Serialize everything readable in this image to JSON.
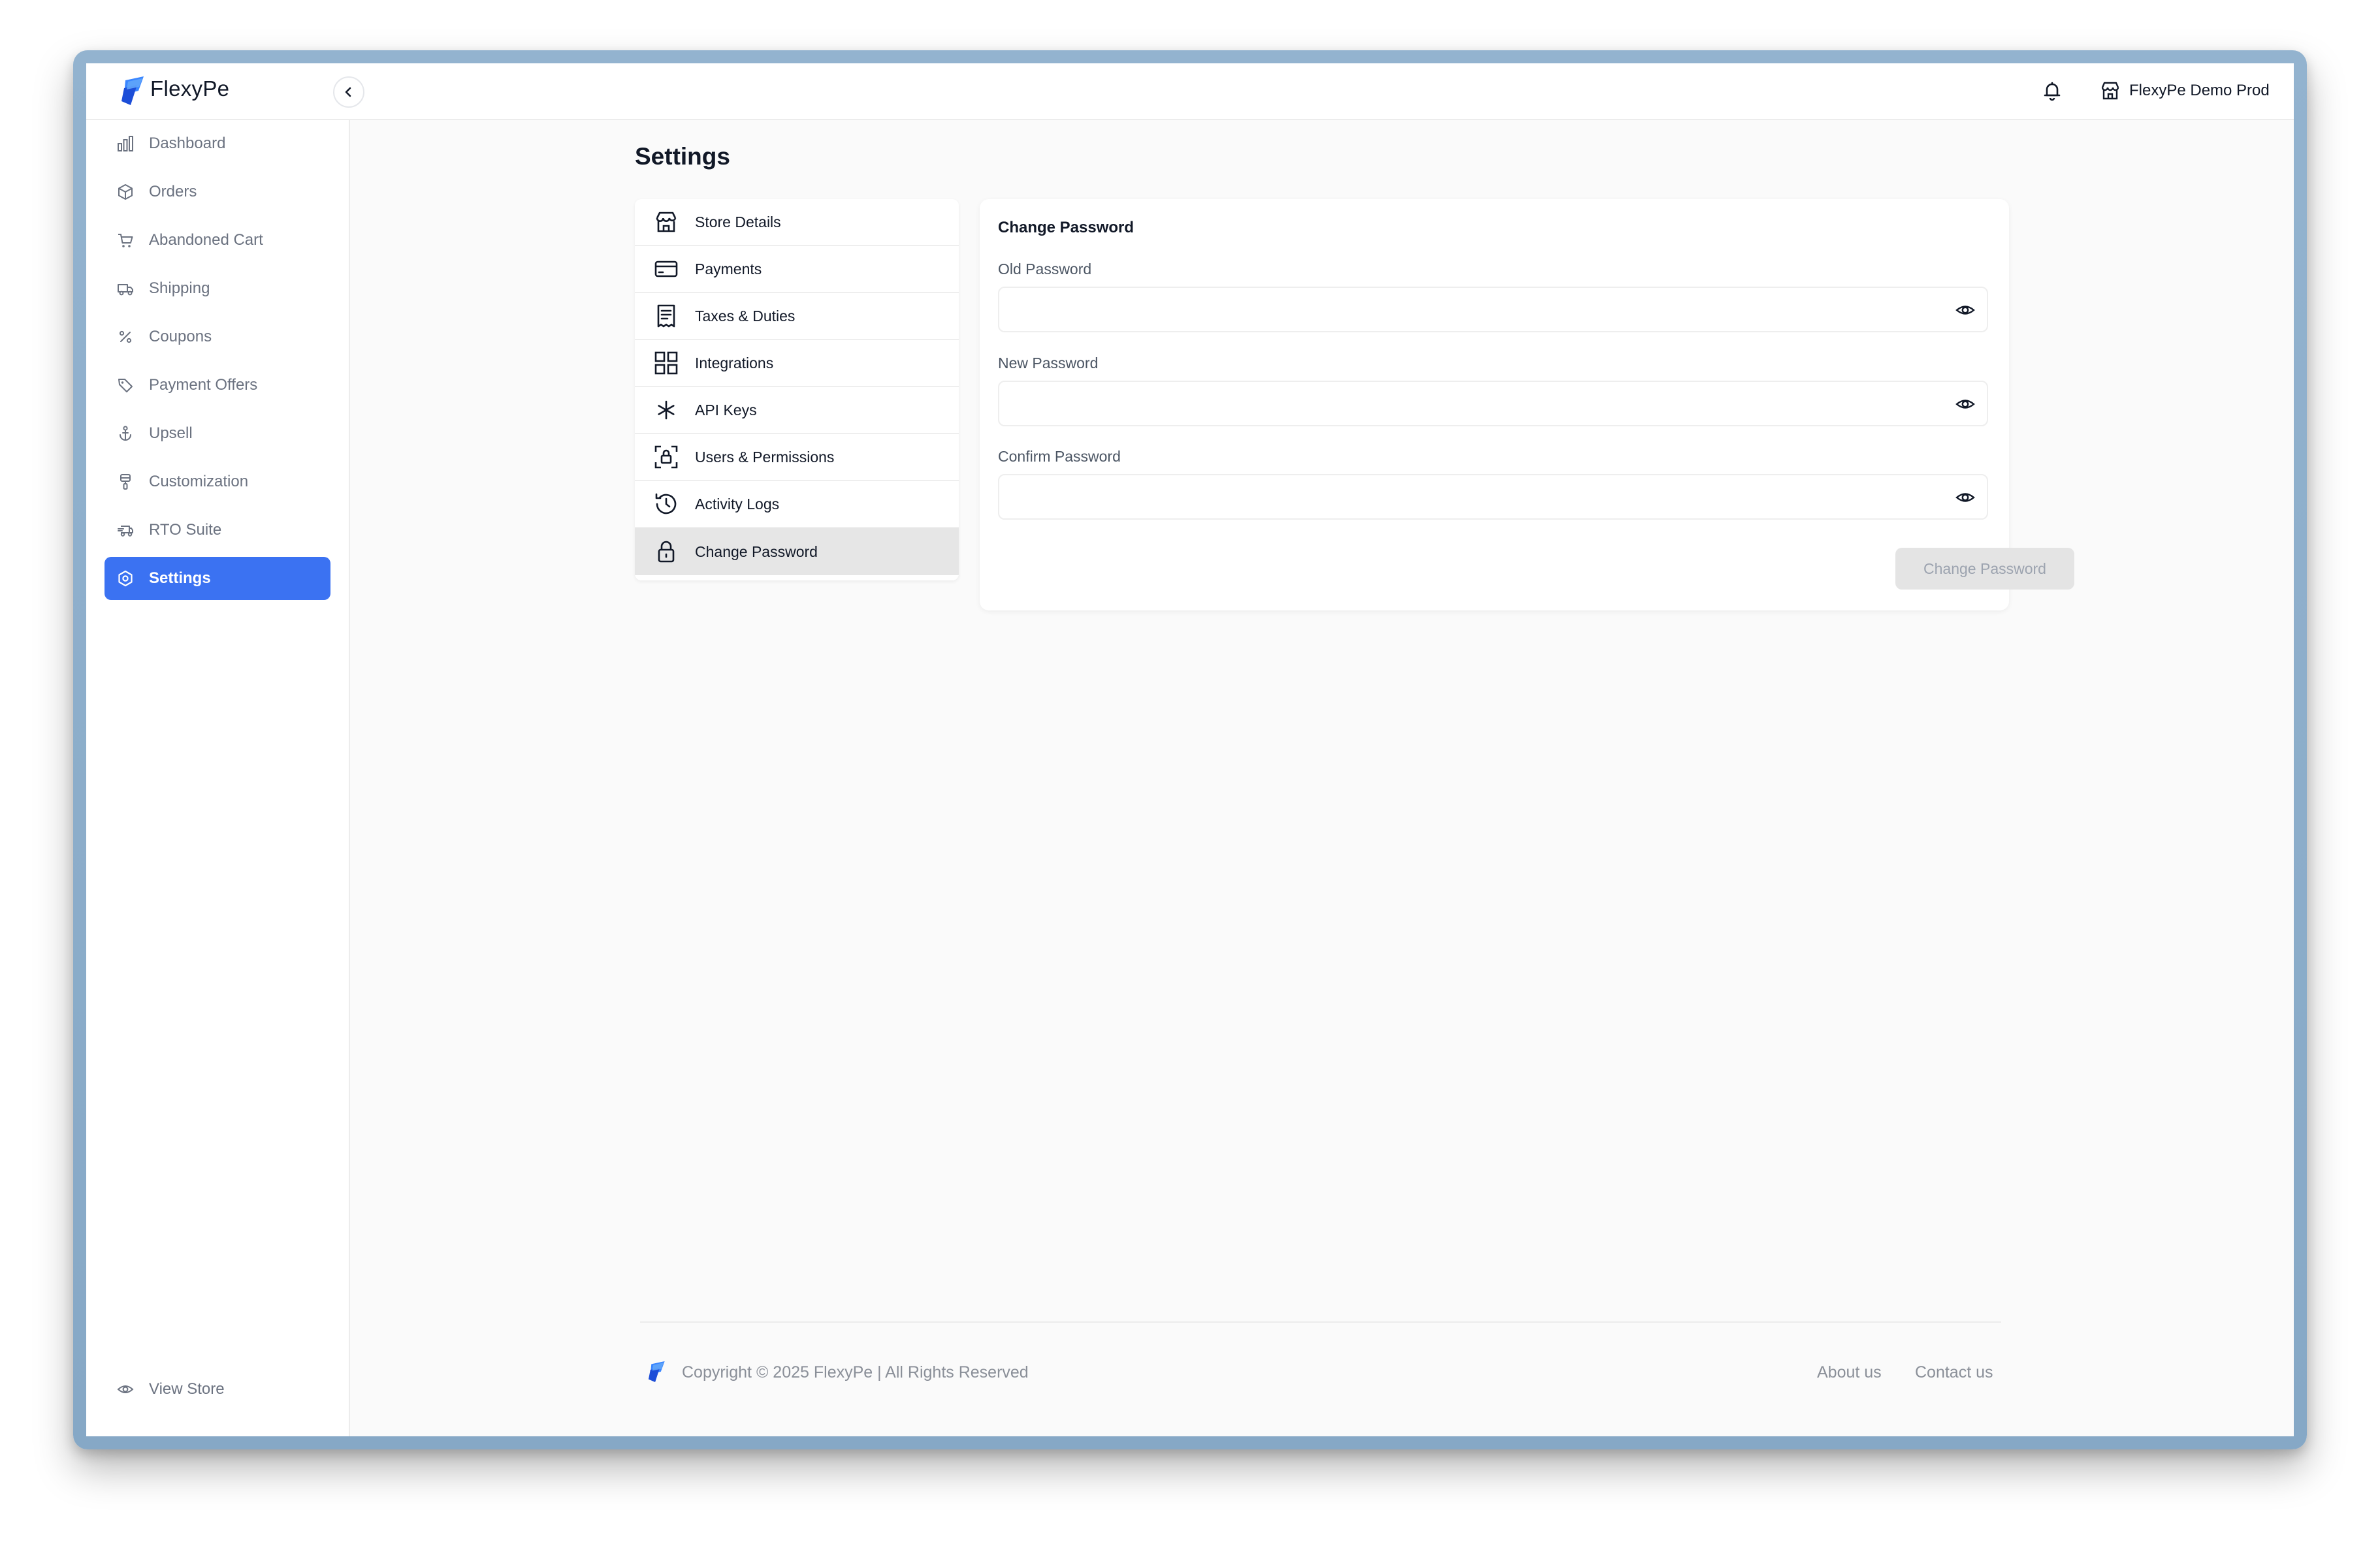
{
  "header": {
    "brand": "FlexyPe",
    "store_name": "FlexyPe Demo Prod"
  },
  "sidebar": {
    "items": [
      {
        "label": "Dashboard",
        "icon": "bar-chart-icon"
      },
      {
        "label": "Orders",
        "icon": "package-icon"
      },
      {
        "label": "Abandoned Cart",
        "icon": "cart-icon"
      },
      {
        "label": "Shipping",
        "icon": "truck-icon"
      },
      {
        "label": "Coupons",
        "icon": "percent-icon"
      },
      {
        "label": "Payment Offers",
        "icon": "tag-icon"
      },
      {
        "label": "Upsell",
        "icon": "anchor-icon"
      },
      {
        "label": "Customization",
        "icon": "paint-brush-icon"
      },
      {
        "label": "RTO Suite",
        "icon": "truck-return-icon"
      },
      {
        "label": "Settings",
        "icon": "gear-icon",
        "active": true
      }
    ],
    "view_store": "View Store"
  },
  "main": {
    "title": "Settings",
    "settings_menu": [
      {
        "label": "Store Details",
        "icon": "storefront-icon"
      },
      {
        "label": "Payments",
        "icon": "credit-card-icon"
      },
      {
        "label": "Taxes & Duties",
        "icon": "receipt-icon"
      },
      {
        "label": "Integrations",
        "icon": "grid-icon"
      },
      {
        "label": "API Keys",
        "icon": "asterisk-icon"
      },
      {
        "label": "Users & Permissions",
        "icon": "user-lock-icon"
      },
      {
        "label": "Activity Logs",
        "icon": "history-icon"
      },
      {
        "label": "Change Password",
        "icon": "lock-icon",
        "active": true
      }
    ],
    "change_password": {
      "title": "Change Password",
      "old_label": "Old Password",
      "old_value": "",
      "new_label": "New Password",
      "new_value": "",
      "confirm_label": "Confirm Password",
      "confirm_value": "",
      "submit_label": "Change Password",
      "submit_enabled": false
    }
  },
  "footer": {
    "copyright": "Copyright © 2025 FlexyPe | All Rights Reserved",
    "about": "About us",
    "contact": "Contact us"
  },
  "colors": {
    "accent": "#3b72f2",
    "frame": "#8fb0cd",
    "active_menu_bg": "#e6e6e6",
    "disabled_button_bg": "#e4e4e4"
  }
}
